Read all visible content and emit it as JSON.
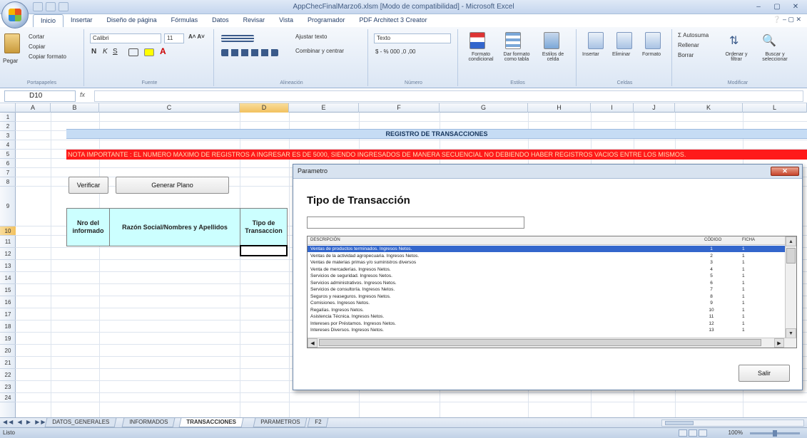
{
  "window": {
    "title": "AppChecFinalMarzo6.xlsm [Modo de compatibilidad] - Microsoft Excel",
    "controls": [
      "–",
      "▢",
      "✕"
    ]
  },
  "ribbon": {
    "tabs": [
      "Inicio",
      "Insertar",
      "Diseño de página",
      "Fórmulas",
      "Datos",
      "Revisar",
      "Vista",
      "Programador",
      "PDF Architect 3 Creator"
    ],
    "active_tab": "Inicio",
    "clipboard": {
      "paste": "Pegar",
      "cut": "Cortar",
      "copy": "Copiar",
      "format_painter": "Copiar formato",
      "label": "Portapapeles"
    },
    "font": {
      "name": "Calibri",
      "size": "11",
      "label": "Fuente",
      "bold": "N",
      "italic": "K",
      "underline": "S"
    },
    "alignment": {
      "wrap": "Ajustar texto",
      "merge": "Combinar y centrar",
      "label": "Alineación"
    },
    "number": {
      "format": "Texto",
      "label": "Número"
    },
    "styles": {
      "conditional": "Formato condicional",
      "table": "Dar formato como tabla",
      "cell": "Estilos de celda",
      "label": "Estilos"
    },
    "cells": {
      "insert": "Insertar",
      "delete": "Eliminar",
      "format": "Formato",
      "label": "Celdas"
    },
    "editing": {
      "autosum": "Autosuma",
      "fill": "Rellenar",
      "clear": "Borrar",
      "sort": "Ordenar y filtrar",
      "find": "Buscar y seleccionar",
      "label": "Modificar"
    }
  },
  "formula_bar": {
    "name_box": "D10",
    "fx": "fx",
    "content": ""
  },
  "columns": [
    "A",
    "B",
    "C",
    "D",
    "E",
    "F",
    "G",
    "H",
    "I",
    "J",
    "K",
    "L"
  ],
  "selected_column": "D",
  "rows": [
    "1",
    "2",
    "3",
    "4",
    "5",
    "6",
    "7",
    "8",
    "9",
    "10",
    "11",
    "12",
    "13",
    "14",
    "15",
    "16",
    "17",
    "18",
    "19",
    "20",
    "21",
    "22",
    "23",
    "24"
  ],
  "selected_row": "10",
  "sheet": {
    "banner_title": "REGISTRO DE TRANSACCIONES",
    "banner_note": "NOTA IMPORTANTE : EL NUMERO MAXIMO DE REGISTROS A INGRESAR ES DE 5000, SIENDO INGRESADOS DE MANERA SECUENCIAL NO DEBIENDO HABER REGISTROS VACIOS ENTRE LOS MISMOS.",
    "btn_verify": "Verificar",
    "btn_generate": "Generar Plano",
    "col_nro": "Nro del informado",
    "col_razon": "Razón Social/Nombres y Apellidos",
    "col_tipo": "Tipo de Transaccion"
  },
  "sheet_tabs": [
    "DATOS_GENERALES",
    "INFORMADOS",
    "TRANSACCIONES",
    "PARAMETROS",
    "F2"
  ],
  "active_sheet": "TRANSACCIONES",
  "status": {
    "text": "Listo",
    "zoom": "100%"
  },
  "dialog": {
    "title": "Parametro",
    "close": "✕",
    "heading": "Tipo de Transacción",
    "search_value": "",
    "list_headers": [
      "DESCRIPCIÓN",
      "CÓDIGO",
      "FICHA"
    ],
    "list_items": [
      {
        "desc": "Ventas de productos terminados. Ingresos Netos.",
        "code": "1",
        "ficha": "1"
      },
      {
        "desc": "Ventas de la actividad agropecuaria. Ingresos Netos.",
        "code": "2",
        "ficha": "1"
      },
      {
        "desc": "Ventas de materias primas y/o suministros diversos",
        "code": "3",
        "ficha": "1"
      },
      {
        "desc": "Venta de mercaderías. Ingresos Netos.",
        "code": "4",
        "ficha": "1"
      },
      {
        "desc": "Servicios de seguridad. Ingresos Netos.",
        "code": "5",
        "ficha": "1"
      },
      {
        "desc": "Servicios administrativos. Ingresos Netos.",
        "code": "6",
        "ficha": "1"
      },
      {
        "desc": "Servicios de consultoría. Ingresos Netos.",
        "code": "7",
        "ficha": "1"
      },
      {
        "desc": "Seguros y reaseguros. Ingresos Netos.",
        "code": "8",
        "ficha": "1"
      },
      {
        "desc": "Comisiones. Ingresos Netos.",
        "code": "9",
        "ficha": "1"
      },
      {
        "desc": "Regalías. Ingresos Netos.",
        "code": "10",
        "ficha": "1"
      },
      {
        "desc": "Asistencia Técnica. Ingresos Netos.",
        "code": "11",
        "ficha": "1"
      },
      {
        "desc": "Intereses por Préstamos. Ingresos Netos.",
        "code": "12",
        "ficha": "1"
      },
      {
        "desc": "Intereses Diversos. Ingresos Netos.",
        "code": "13",
        "ficha": "1"
      }
    ],
    "selected_index": 0,
    "btn_exit": "Salir"
  }
}
